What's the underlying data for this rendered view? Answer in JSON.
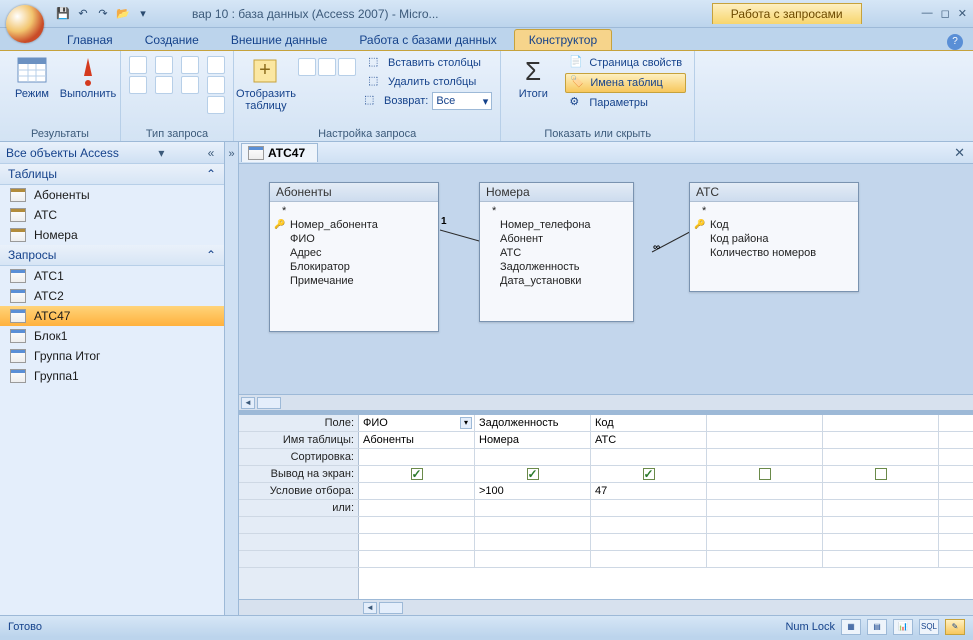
{
  "title": "вар 10 : база данных (Access 2007) - Micro...",
  "context_tab_group": "Работа с запросами",
  "ribbon_tabs": [
    "Главная",
    "Создание",
    "Внешние данные",
    "Работа с базами данных",
    "Конструктор"
  ],
  "active_tab_index": 4,
  "ribbon": {
    "results": {
      "group": "Результаты",
      "mode": "Режим",
      "run": "Выполнить"
    },
    "query_type": {
      "group": "Тип запроса"
    },
    "setup": {
      "group": "Настройка запроса",
      "show_table": "Отобразить\nтаблицу",
      "insert_cols": "Вставить столбцы",
      "delete_cols": "Удалить столбцы",
      "return_label": "Возврат:",
      "return_value": "Все"
    },
    "totals": {
      "group": "",
      "label": "Итоги"
    },
    "show_hide": {
      "group": "Показать или скрыть",
      "prop_page": "Страница свойств",
      "table_names": "Имена таблиц",
      "parameters": "Параметры"
    }
  },
  "nav": {
    "header": "Все объекты Access",
    "groups": [
      {
        "name": "Таблицы",
        "type": "table",
        "items": [
          "Абоненты",
          "АТС",
          "Номера"
        ]
      },
      {
        "name": "Запросы",
        "type": "query",
        "items": [
          "АТС1",
          "АТС2",
          "АТС47",
          "Блок1",
          "Группа Итог",
          "Группа1"
        ],
        "selected": "АТС47"
      }
    ]
  },
  "doc_tab": "ATC47",
  "tables": {
    "t1": {
      "title": "Абоненты",
      "fields": [
        "*",
        "Номер_абонента",
        "ФИО",
        "Адрес",
        "Блокиратор",
        "Примечание"
      ],
      "key": 1
    },
    "t2": {
      "title": "Номера",
      "fields": [
        "*",
        "Номер_телефона",
        "Абонент",
        "АТС",
        "Задолженность",
        "Дата_установки"
      ]
    },
    "t3": {
      "title": "АТС",
      "fields": [
        "*",
        "Код",
        "Код района",
        "Количество номеров"
      ],
      "key": 1
    }
  },
  "qbe": {
    "labels": {
      "field": "Поле:",
      "table": "Имя таблицы:",
      "sort": "Сортировка:",
      "show": "Вывод на экран:",
      "criteria": "Условие отбора:",
      "or": "или:"
    },
    "cols": [
      {
        "field": "ФИО",
        "table": "Абоненты",
        "show": true,
        "criteria": ""
      },
      {
        "field": "Задолженность",
        "table": "Номера",
        "show": true,
        "criteria": ">100"
      },
      {
        "field": "Код",
        "table": "АТС",
        "show": true,
        "criteria": "47"
      },
      {
        "field": "",
        "table": "",
        "show": false,
        "criteria": ""
      },
      {
        "field": "",
        "table": "",
        "show": false,
        "criteria": ""
      }
    ]
  },
  "status": {
    "ready": "Готово",
    "numlock": "Num Lock",
    "sql": "SQL"
  }
}
